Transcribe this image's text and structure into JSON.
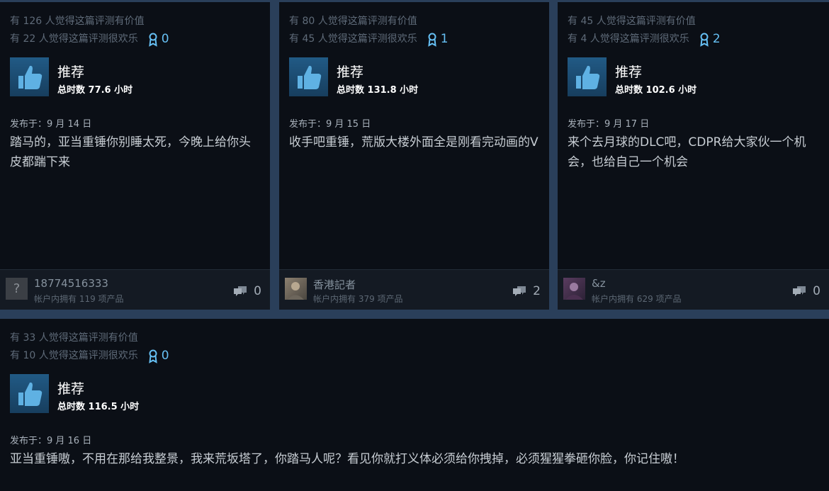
{
  "reviews": [
    {
      "helpful": "有 126 人觉得这篇评测有价值",
      "funny": "有 22 人觉得这篇评测很欢乐",
      "awards": "0",
      "recommendation": "推荐",
      "hours": "总时数 77.6 小时",
      "posted": "发布于：9 月 14 日",
      "text": "踏马的，亚当重锤你别睡太死，今晚上给你头皮都踹下来",
      "author": "18774516333",
      "products": "帐户内拥有 119 项产品",
      "comments": "0"
    },
    {
      "helpful": "有 80 人觉得这篇评测有价值",
      "funny": "有 45 人觉得这篇评测很欢乐",
      "awards": "1",
      "recommendation": "推荐",
      "hours": "总时数 131.8 小时",
      "posted": "发布于：9 月 15 日",
      "text": "收手吧重锤，荒版大楼外面全是刚看完动画的V",
      "author": "香港記者",
      "products": "帐户内拥有 379 项产品",
      "comments": "2"
    },
    {
      "helpful": "有 45 人觉得这篇评测有价值",
      "funny": "有 4 人觉得这篇评测很欢乐",
      "awards": "2",
      "recommendation": "推荐",
      "hours": "总时数 102.6 小时",
      "posted": "发布于：9 月 17 日",
      "text": "来个去月球的DLC吧，CDPR给大家伙一个机会，也给自己一个机会",
      "author": "&z",
      "products": "帐户内拥有 629 项产品",
      "comments": "0"
    },
    {
      "helpful": "有 33 人觉得这篇评测有价值",
      "funny": "有 10 人觉得这篇评测很欢乐",
      "awards": "0",
      "recommendation": "推荐",
      "hours": "总时数 116.5 小时",
      "posted": "发布于：9 月 16 日",
      "text": "亚当重锤嗷，不用在那给我整景，我来荒坂塔了，你踏马人呢？看见你就打义体必须给你拽掉，必须猩猩拳砸你脸，你记住嗷！"
    }
  ],
  "icons": {
    "thumb": "thumbs-up-icon",
    "award": "award-ribbon-icon",
    "comment": "comment-bubble-icon",
    "avatar_placeholder": "?"
  },
  "colors": {
    "award": "#66c0f4",
    "thumb_bg": "#1d4a6f"
  }
}
